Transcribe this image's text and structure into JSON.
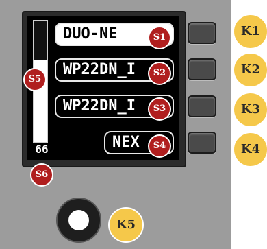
{
  "display": {
    "channels": [
      {
        "label": "DUO-NE",
        "selected": true,
        "marker": "S1"
      },
      {
        "label": "WP22DN_I",
        "selected": false,
        "marker": "S2"
      },
      {
        "label": "WP22DN_I",
        "selected": false,
        "marker": "S3"
      },
      {
        "label": "NEX",
        "selected": false,
        "marker": "S4"
      }
    ],
    "level_meter": {
      "marker": "S5",
      "fill_fraction": 0.68
    },
    "level_value": {
      "text": "66",
      "marker": "S6"
    }
  },
  "keys": [
    {
      "label": "K1"
    },
    {
      "label": "K2"
    },
    {
      "label": "K3"
    },
    {
      "label": "K4"
    }
  ],
  "knob": {
    "label": "K5"
  },
  "colors": {
    "marker_red": "#b01e1e",
    "key_label_yellow": "#f5c84a",
    "panel_gray": "#9c9c9c"
  }
}
